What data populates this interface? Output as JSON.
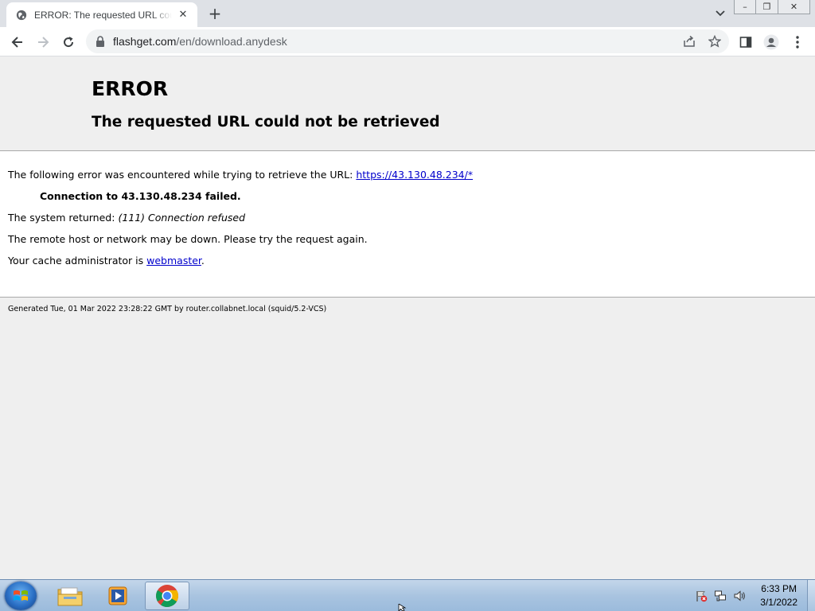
{
  "browser": {
    "tab": {
      "title": "ERROR: The requested URL could not be retrieved"
    },
    "address": {
      "host": "flashget.com",
      "path": "/en/download.anydesk"
    },
    "window_controls": {
      "minimize": "–",
      "restore": "❐",
      "close": "✕"
    }
  },
  "page": {
    "title": "ERROR",
    "subtitle": "The requested URL could not be retrieved",
    "line1_text": "The following error was encountered while trying to retrieve the URL:",
    "line1_link": "https://43.130.48.234/*",
    "line2": "Connection to 43.130.48.234 failed.",
    "line3_text": "The system returned:",
    "line3_em": "(111) Connection refused",
    "line4": "The remote host or network may be down. Please try the request again.",
    "line5_text": "Your cache administrator is",
    "line5_link": "webmaster",
    "line5_end": ".",
    "footer": "Generated Tue, 01 Mar 2022 23:28:22 GMT by router.collabnet.local (squid/5.2-VCS)"
  },
  "taskbar": {
    "apps": [
      "windows-explorer",
      "media-player",
      "google-chrome"
    ],
    "clock": {
      "time": "6:33 PM",
      "date": "3/1/2022"
    }
  },
  "colors": {
    "link": "#0000cc",
    "tab_strip": "#dee1e6",
    "taskbar": "#a9c4e0"
  }
}
